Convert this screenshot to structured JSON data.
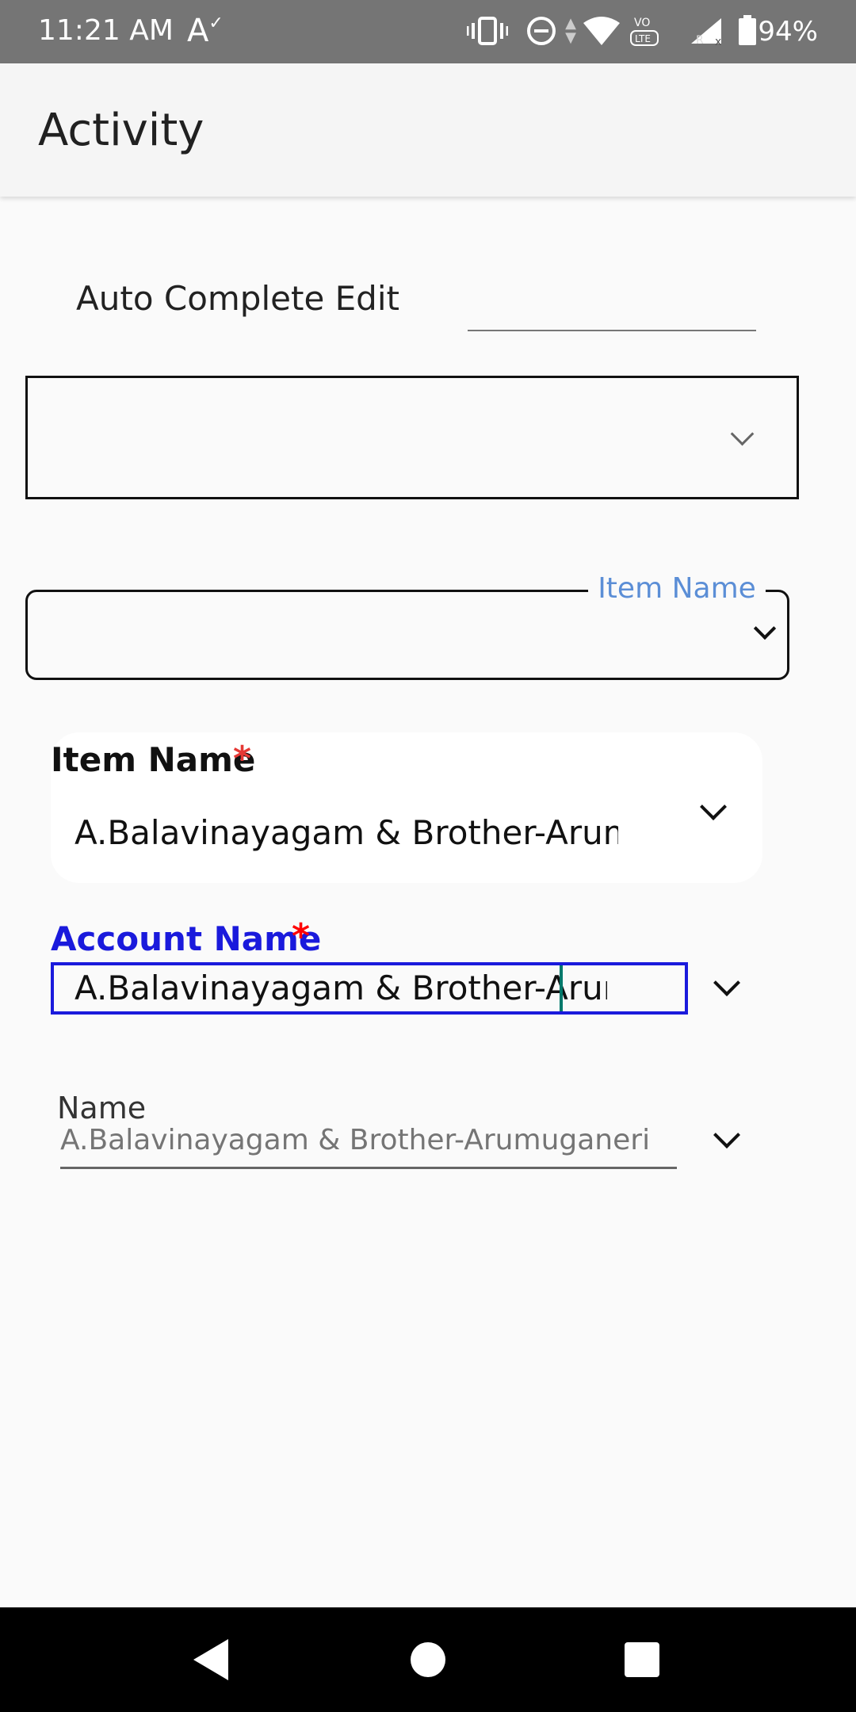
{
  "status_bar": {
    "time": "11:21 AM",
    "battery_percent": "94%",
    "icons": [
      "font-accessibility-icon",
      "vibrate-icon",
      "dnd-icon",
      "wifi-icon",
      "volte-icon",
      "signal-icon",
      "battery-icon"
    ]
  },
  "app_bar": {
    "title": "Activity"
  },
  "autocomplete": {
    "label": "Auto Complete Edit",
    "value": ""
  },
  "outlined_dropdown": {
    "floating_label": "Item Name"
  },
  "item_name": {
    "label": "Item Name",
    "required_mark": "*",
    "value": "A.Balavinayagam & Brother-Arumug"
  },
  "account_name": {
    "label": "Account Name",
    "required_mark": "*",
    "value": "A.Balavinayagam & Brother-Arumu"
  },
  "name_field": {
    "label": "Name",
    "value": "A.Balavinayagam & Brother-Arumuganeri"
  },
  "colors": {
    "account_label": "#1a1adc",
    "required_star_item": "#e53935",
    "required_star_account": "#ff0000",
    "floating_label": "#5b8ed6",
    "status_bar_bg": "#757575",
    "nav_bar_bg": "#000000"
  }
}
